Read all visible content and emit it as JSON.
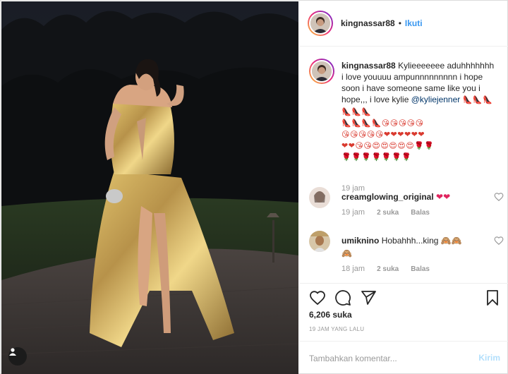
{
  "post": {
    "username": "kingnassar88",
    "separator": "•",
    "follow_label": "Ikuti",
    "caption_text": "Kylieeeeeee aduhhhhhhh i love youuuu ampunnnnnnnnn i hope soon i have someone same like you i hope,,, i love kylie",
    "caption_mention": "@kyliejenner",
    "caption_emoji_rows": [
      "👠👠👠👠👠👠",
      "👠👠👠👠😘😘😘😘😘",
      "😘😘😘😘😘❤❤❤❤❤❤",
      "❤❤😘😘😍😍😍😍😍🌹🌹",
      "🌹🌹🌹🌹🌹🌹🌹"
    ],
    "caption_time": "19 jam"
  },
  "comments": [
    {
      "username": "creamglowing_original",
      "text": "❤❤",
      "time": "19 jam",
      "likes": "2 suka",
      "reply": "Balas"
    },
    {
      "username": "umiknino",
      "text": "Hobahhh...king 🙈🙈",
      "text_extra": "🙈",
      "time": "18 jam",
      "likes": "2 suka",
      "reply": "Balas"
    }
  ],
  "actions": {
    "like_icon": "heart-icon",
    "comment_icon": "comment-icon",
    "share_icon": "share-icon",
    "save_icon": "bookmark-icon"
  },
  "likes_count": "6,206 suka",
  "posted_time": "19 JAM YANG LALU",
  "composer": {
    "placeholder": "Tambahkan komentar...",
    "send_label": "Kirim"
  },
  "colors": {
    "link": "#3897f0",
    "mention": "#003569",
    "muted": "#999999",
    "send_disabled": "#b2dffc"
  }
}
